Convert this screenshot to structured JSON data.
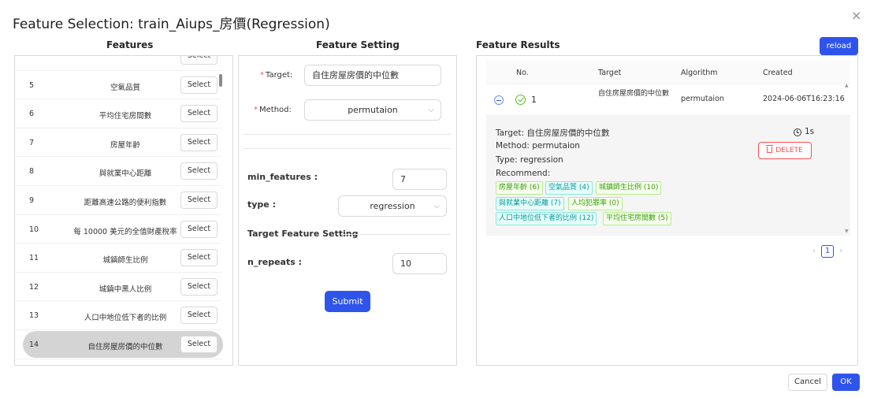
{
  "dialog": {
    "title": "Feature Selection: train_Aiups_房價(Regression)",
    "close_icon": "×"
  },
  "features": {
    "heading": "Features",
    "select_label": "Select",
    "items": [
      {
        "no": "",
        "name": ""
      },
      {
        "no": "5",
        "name": "空氣品質"
      },
      {
        "no": "6",
        "name": "平均住宅房間數"
      },
      {
        "no": "7",
        "name": "房屋年齡"
      },
      {
        "no": "8",
        "name": "與就業中心距離"
      },
      {
        "no": "9",
        "name": "距離高速公路的便利指數"
      },
      {
        "no": "10",
        "name": "每 10000 美元的全值財產稅率"
      },
      {
        "no": "11",
        "name": "城鎮師生比例"
      },
      {
        "no": "12",
        "name": "城鎮中黑人比例"
      },
      {
        "no": "13",
        "name": "人口中地位低下者的比例"
      },
      {
        "no": "14",
        "name": "自住房屋房價的中位數"
      }
    ]
  },
  "setting": {
    "heading": "Feature Setting",
    "target_label": "Target:",
    "target_value": "自住房屋房價的中位數",
    "method_label": "Method:",
    "method_value": "permutaion",
    "min_features_label": "min_features :",
    "min_features_value": "7",
    "type_label": "type :",
    "type_value": "regression",
    "target_feature_setting": "Target Feature Setting",
    "n_repeats_label": "n_repeats :",
    "n_repeats_value": "10",
    "submit_label": "Submit"
  },
  "results": {
    "heading": "Feature Results",
    "reload_label": "reload",
    "columns": [
      "No.",
      "Target",
      "Algorithm",
      "Created"
    ],
    "row": {
      "no": "1",
      "target": "自住房屋房價的中位數",
      "algorithm": "permutaion",
      "created": "2024-06-06T16:23:16"
    },
    "detail": {
      "target_line": "Target: 自住房屋房價的中位數",
      "method_line": "Method: permutaion",
      "type_line": "Type: regression",
      "recommend_line": "Recommend:",
      "duration": "1s",
      "delete_label": "DELETE",
      "tags": [
        {
          "text": "房屋年齡 (6)",
          "color": "green"
        },
        {
          "text": "空氣品質 (4)",
          "color": "cyan"
        },
        {
          "text": "城鎮師生比例 (10)",
          "color": "green"
        },
        {
          "text": "與就業中心距離 (7)",
          "color": "cyan"
        },
        {
          "text": "人均犯罪率 (0)",
          "color": "green"
        },
        {
          "text": "人口中地位低下者的比例 (12)",
          "color": "cyan"
        },
        {
          "text": "平均住宅房間數 (5)",
          "color": "green"
        }
      ]
    },
    "pagination": {
      "prev": "‹",
      "current": "1",
      "next": "›"
    }
  },
  "footer": {
    "cancel_label": "Cancel",
    "ok_label": "OK"
  }
}
